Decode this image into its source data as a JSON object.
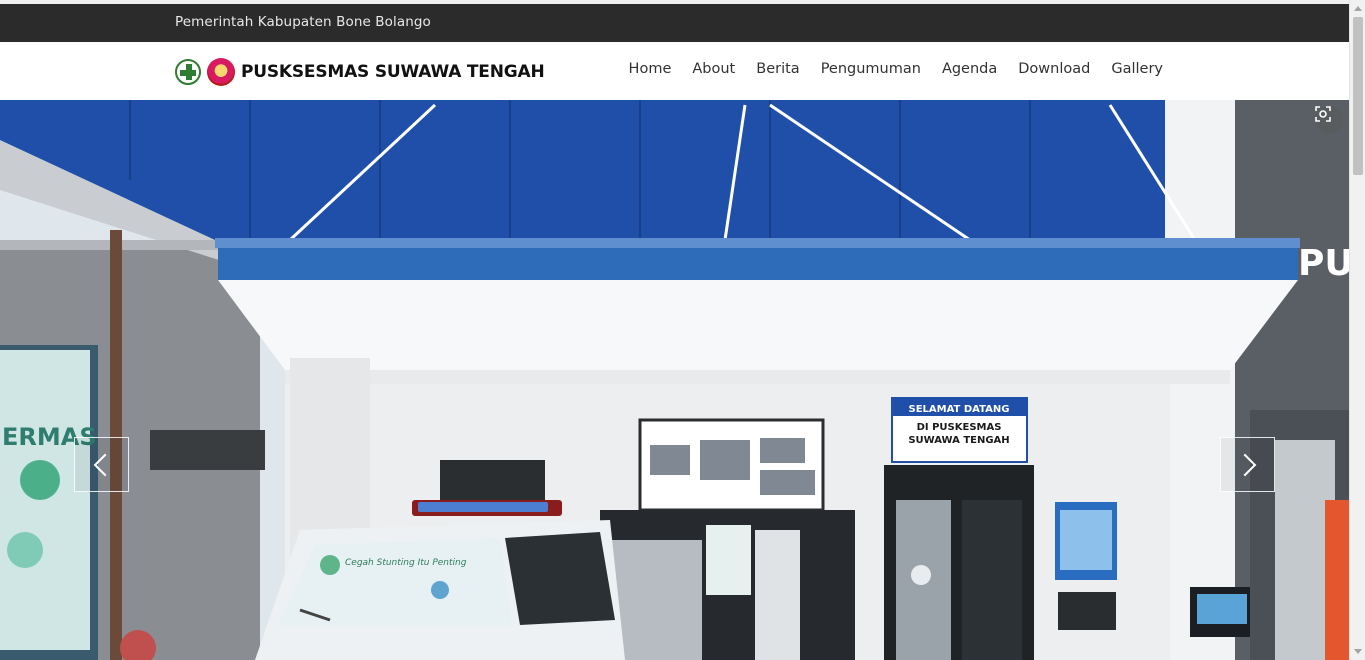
{
  "topbar": {
    "government_label": "Pemerintah Kabupaten Bone Bolango"
  },
  "navbar": {
    "brand_name": "PUSKSESMAS SUWAWA TENGAH",
    "menu": [
      "Home",
      "About",
      "Berita",
      "Pengumuman",
      "Agenda",
      "Download",
      "Gallery"
    ]
  },
  "hero": {
    "sign_welcome": "SELAMAT DATANG",
    "sign_line2": "DI PUSKESMAS",
    "sign_line3": "SUWAWA TENGAH",
    "building_letters": "PU",
    "left_banner_text": "ERMAS",
    "car_sticker": "Cegah Stunting Itu Penting",
    "prev_icon": "chevron-left-icon",
    "next_icon": "chevron-right-icon",
    "lens_icon": "image-search-icon"
  },
  "colors": {
    "topbar": "#2b2b2b",
    "awning_blue": "#1f4fa8",
    "logo_green": "#2e7d32"
  }
}
